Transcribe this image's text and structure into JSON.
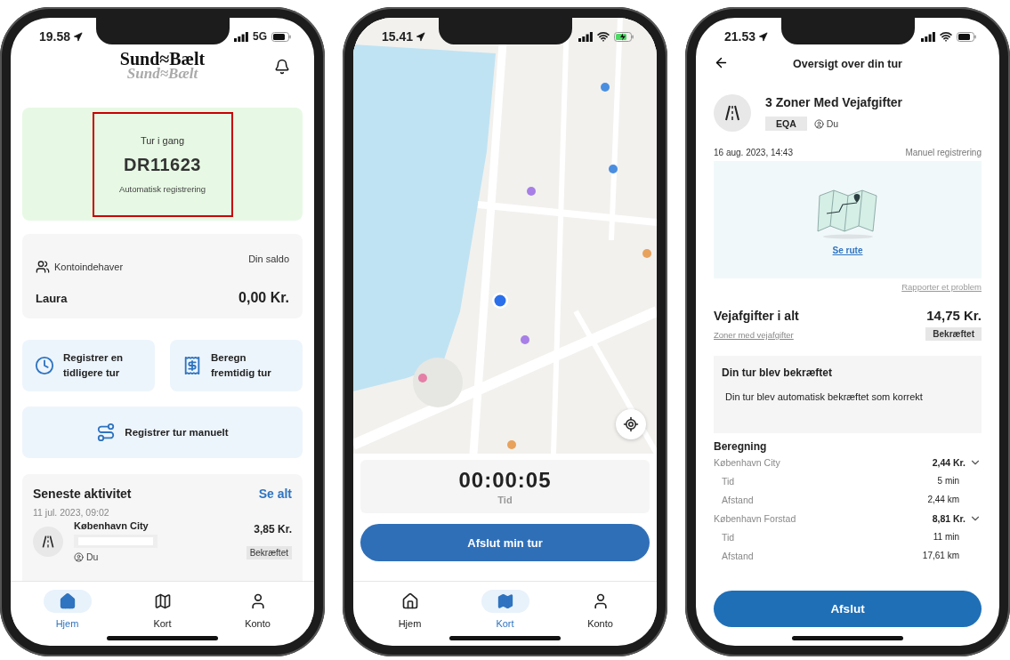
{
  "phones": [
    {
      "kind": "home",
      "status_bar": {
        "time": "19.58",
        "network": "5G",
        "charging": false
      },
      "logo": {
        "text": "Sund≈Bælt",
        "reflection": "Sund≈Bælt"
      },
      "trip_card": {
        "status": "Tur i gang",
        "plate": "DR11623",
        "mode": "Automatisk registrering",
        "highlighted": true
      },
      "account": {
        "holder_label": "Kontoindehaver",
        "holder_name": "Laura",
        "balance_label": "Din saldo",
        "balance": "0,00 Kr."
      },
      "actions": [
        {
          "label": "Registrer en tidligere tur"
        },
        {
          "label": "Beregn fremtidig tur"
        },
        {
          "label": "Registrer tur manuelt"
        }
      ],
      "activity": {
        "title": "Seneste aktivitet",
        "see_all": "Se alt",
        "date": "11 jul. 2023, 09:02",
        "item": {
          "zone": "København City",
          "user": "Du",
          "amount": "3,85 Kr.",
          "status": "Bekræftet"
        }
      },
      "tabs": [
        {
          "label": "Hjem",
          "selected": true
        },
        {
          "label": "Kort",
          "selected": false
        },
        {
          "label": "Konto",
          "selected": false
        }
      ]
    },
    {
      "kind": "map",
      "status_bar": {
        "time": "15.41",
        "charging": true
      },
      "timer": {
        "value": "00:00:05",
        "label": "Tid"
      },
      "end_button": "Afslut min tur",
      "tabs": [
        {
          "label": "Hjem",
          "selected": false
        },
        {
          "label": "Kort",
          "selected": true
        },
        {
          "label": "Konto",
          "selected": false
        }
      ]
    },
    {
      "kind": "summary",
      "status_bar": {
        "time": "21.53",
        "charging": false
      },
      "header": {
        "title": "Oversigt over din tur"
      },
      "trip": {
        "title": "3 Zoner Med Vejafgifter",
        "plate": "EQA",
        "user": "Du"
      },
      "date": "16 aug. 2023, 14:43",
      "registration": "Manuel registrering",
      "route_link": "Se rute",
      "report_link": "Rapporter et problem",
      "total": {
        "label": "Vejafgifter i alt",
        "amount": "14,75 Kr.",
        "link": "Zoner med vejafgifter",
        "status": "Bekræftet"
      },
      "notice": {
        "title": "Din tur blev bekræftet",
        "text": "Din tur blev automatisk bekræftet som korrekt"
      },
      "calculation": {
        "title": "Beregning",
        "zones": [
          {
            "name": "København City",
            "amount": "2,44 Kr.",
            "expanded": true,
            "details": [
              {
                "label": "Tid",
                "value": "5 min"
              },
              {
                "label": "Afstand",
                "value": "2,44 km"
              }
            ]
          },
          {
            "name": "København Forstad",
            "amount": "8,81 Kr.",
            "expanded": true,
            "details": [
              {
                "label": "Tid",
                "value": "11 min"
              },
              {
                "label": "Afstand",
                "value": "17,61 km"
              }
            ]
          }
        ]
      },
      "finish_button": "Afslut"
    }
  ]
}
